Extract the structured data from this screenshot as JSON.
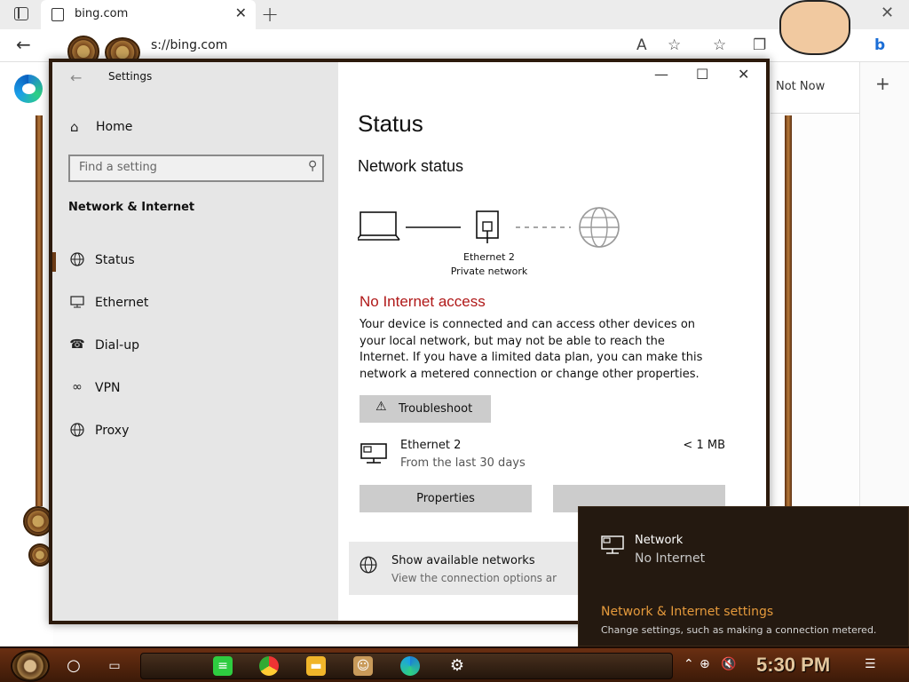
{
  "browser": {
    "tab_title": "bing.com",
    "url": "s://bing.com",
    "not_now": "Not Now"
  },
  "settings": {
    "title": "Settings",
    "home": "Home",
    "search_placeholder": "Find a setting",
    "section": "Network & Internet",
    "nav_items": [
      {
        "label": "Status",
        "icon": "globe-icon"
      },
      {
        "label": "Ethernet",
        "icon": "ethernet-icon"
      },
      {
        "label": "Dial-up",
        "icon": "dialup-icon"
      },
      {
        "label": "VPN",
        "icon": "vpn-icon"
      },
      {
        "label": "Proxy",
        "icon": "proxy-icon"
      }
    ],
    "page_title": "Status",
    "network_status": "Network status",
    "adapter_name": "Ethernet 2",
    "adapter_profile": "Private network",
    "no_internet": "No Internet access",
    "description": "Your device is connected and can access other devices on your local network, but may not be able to reach the Internet. If you have a limited data plan, you can make this network a metered connection or change other properties.",
    "troubleshoot": "Troubleshoot",
    "usage_name": "Ethernet 2",
    "usage_period": "From the last 30 days",
    "usage_size": "< 1 MB",
    "properties": "Properties",
    "show_networks": "Show available networks",
    "show_networks_sub": "View the connection options ar"
  },
  "flyout": {
    "network": "Network",
    "status": "No Internet",
    "settings_link": "Network & Internet settings",
    "settings_sub": "Change settings, such as making a connection metered."
  },
  "taskbar": {
    "time": "5:30 PM"
  },
  "colors": {
    "error_red": "#b01818",
    "accent_orange": "#e59a3c",
    "nav_bg": "#e6e6e6"
  }
}
